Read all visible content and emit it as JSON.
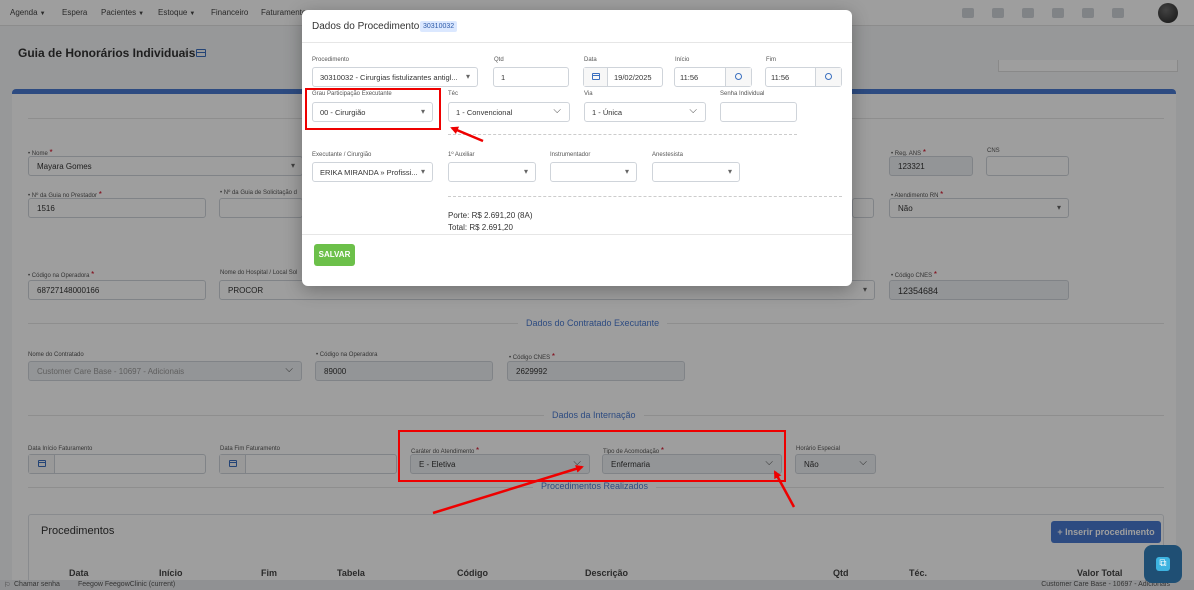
{
  "nav": {
    "items": [
      "Agenda",
      "Espera",
      "Pacientes",
      "Estoque",
      "Financeiro",
      "Faturamento"
    ]
  },
  "page": {
    "title": "Guia de Honorários Individuais"
  },
  "form": {
    "nome_label": "Nome",
    "nome_value": "Mayara Gomes",
    "reg_ans_label": "Reg. ANS",
    "reg_ans_value": "123321",
    "cns_label": "CNS",
    "guia_prestador_label": "Nº da Guia no Prestador",
    "guia_prestador_value": "1516",
    "guia_solicitacao_label": "Nº da Guia de Solicitação d",
    "atendimento_rn_label": "Atendimento RN",
    "atendimento_rn_value": "Não",
    "codigo_operadora_label": "Código na Operadora",
    "codigo_operadora_value": "68727148000166",
    "hospital_label": "Nome do Hospital / Local Sol",
    "hospital_value": "PROCOR",
    "codigo_cnes_label": "Código CNES",
    "codigo_cnes_value": "12354684"
  },
  "contratado": {
    "section_title": "Dados do Contratado Executante",
    "nome_label": "Nome do Contratado",
    "nome_value": "Customer Care Base - 10697 - Adicionais",
    "codigo_operadora_label": "Código na Operadora",
    "codigo_operadora_value": "89000",
    "cnes_label": "Código CNES",
    "cnes_value": "2629992"
  },
  "internacao": {
    "section_title": "Dados da Internação",
    "data_inicio_label": "Data Início Faturamento",
    "data_fim_label": "Data Fim Faturamento",
    "carater_label": "Caráter do Atendimento",
    "carater_value": "E - Eletiva",
    "acomodacao_label": "Tipo de Acomodação",
    "acomodacao_value": "Enfermaria",
    "horario_label": "Horário Especial",
    "horario_value": "Não"
  },
  "procedimentos": {
    "section_title": "Procedimentos Realizados",
    "box_title": "Procedimentos",
    "add_button": "+ Inserir procedimento",
    "columns": [
      "Data",
      "Início",
      "Fim",
      "Tabela",
      "Código",
      "Descrição",
      "Qtd",
      "Téc.",
      "Valor Total"
    ]
  },
  "bottombar": {
    "left": "Chamar senha",
    "env": "Feegow FeegowClinic (current)",
    "right": "Customer Care Base - 10697 - Adicionais"
  },
  "modal": {
    "title": "Dados do Procedimento",
    "badge": "30310032",
    "procedimento_label": "Procedimento",
    "procedimento_value": "30310032 - Cirurgias fistulizantes antigl...",
    "qtd_label": "Qtd",
    "qtd_value": "1",
    "data_label": "Data",
    "data_value": "19/02/2025",
    "inicio_label": "Início",
    "inicio_value": "11:56",
    "fim_label": "Fim",
    "fim_value": "11:56",
    "grau_label": "Grau Participação Executante",
    "grau_value": "00 - Cirurgião",
    "tec_label": "Téc",
    "tec_value": "1 - Convencional",
    "via_label": "Via",
    "via_value": "1 - Única",
    "senha_label": "Senha Individual",
    "executante_label": "Executante / Cirurgião",
    "executante_value": "ERIKA MIRANDA » Profissi...",
    "auxiliar_label": "1º Auxiliar",
    "instrumentador_label": "Instrumentador",
    "anestesista_label": "Anestesista",
    "porte_text": "Porte: R$ 2.691,20 (8A)",
    "total_text": "Total: R$ 2.691,20",
    "save_button": "SALVAR"
  },
  "colors": {
    "accent": "#4a7ad0",
    "save": "#6cc04a",
    "highlight": "#e00000"
  }
}
